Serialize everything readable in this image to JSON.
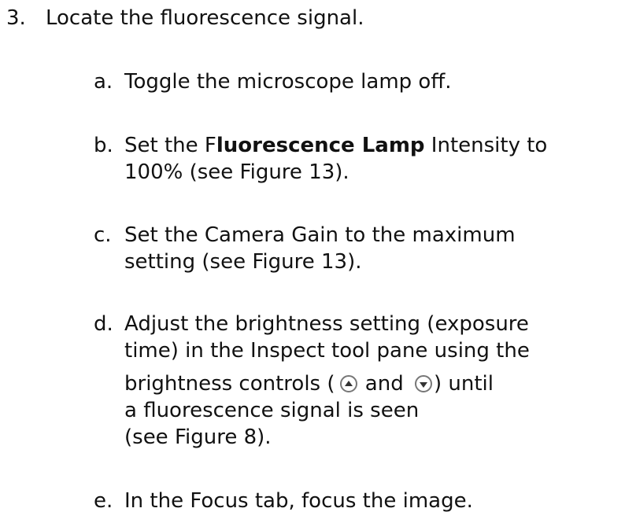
{
  "step": {
    "number": "3.",
    "text": "Locate the fluorescence signal."
  },
  "substeps": {
    "a": {
      "letter": "a.",
      "line1": "Toggle the microscope lamp off."
    },
    "b": {
      "letter": "b.",
      "pre": "Set the F",
      "bold": "luorescence Lamp",
      "post": " Intensity to",
      "line2": "100%  (see Figure 13)."
    },
    "c": {
      "letter": "c.",
      "line1": "Set the Camera Gain to the maximum",
      "line2": "setting  (see Figure 13)."
    },
    "d": {
      "letter": "d.",
      "line1": "Adjust the brightness setting (exposure",
      "line2": "time) in the Inspect tool pane using the",
      "line3_pre": "brightness controls (",
      "line3_mid": " and ",
      "line3_post": ") until",
      "line4": "a fluorescence signal is seen",
      "line5": "(see Figure 8).",
      "icons": [
        "brightness-up-icon",
        "brightness-down-icon"
      ]
    },
    "e": {
      "letter": "e.",
      "line1": "In the Focus tab, focus the image."
    }
  }
}
